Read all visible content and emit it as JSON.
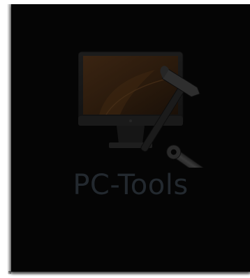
{
  "tile": {
    "label": "PC-Tools",
    "icon": "computer-tools-icon",
    "background_color": "#050505",
    "label_color": "#23292f"
  }
}
